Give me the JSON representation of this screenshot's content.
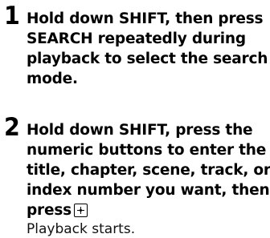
{
  "steps": [
    {
      "number": "1",
      "lines": [
        "Hold down SHIFT, then press",
        "SEARCH repeatedly during",
        "playback to select the search",
        "mode."
      ]
    },
    {
      "number": "2",
      "lines": [
        "Hold down SHIFT, press the",
        "numeric buttons to enter the",
        "title, chapter, scene, track, or",
        "index number you want, then",
        "press"
      ],
      "icon": "enter-button-icon",
      "result": "Playback starts."
    }
  ]
}
